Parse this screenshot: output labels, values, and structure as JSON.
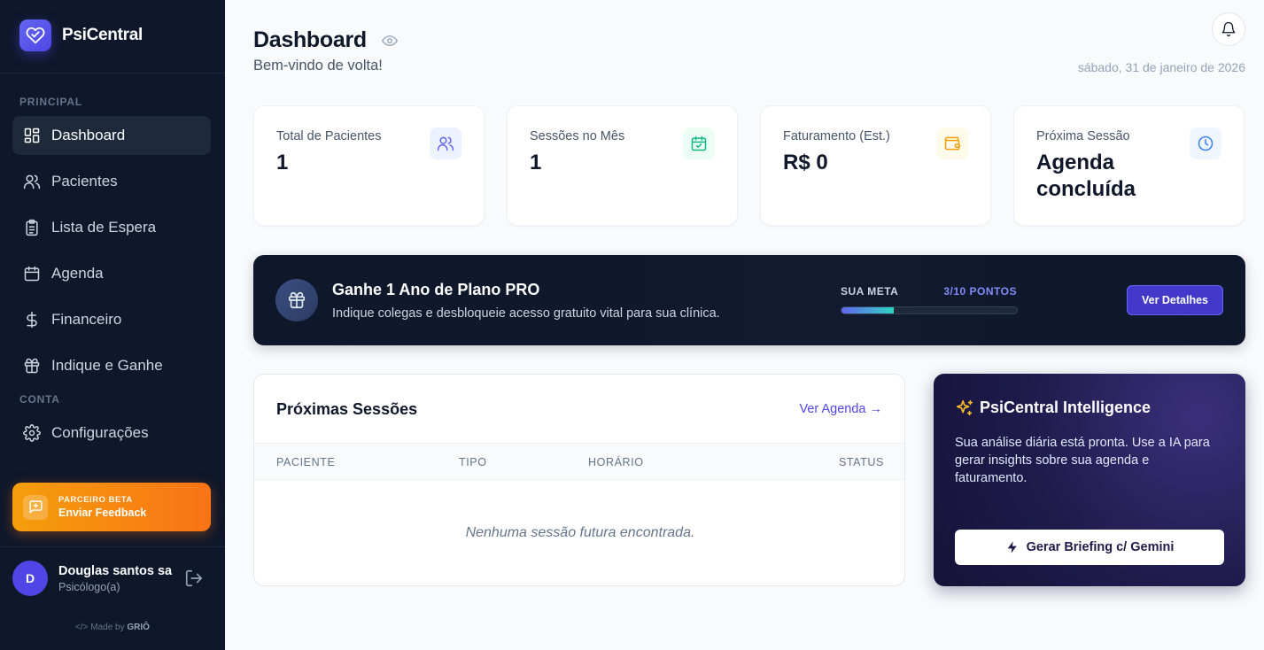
{
  "brand": {
    "name": "PsiCentral"
  },
  "sidebar": {
    "section_principal": "PRINCIPAL",
    "section_conta": "CONTA",
    "items": [
      {
        "label": "Dashboard",
        "icon": "grid-icon"
      },
      {
        "label": "Pacientes",
        "icon": "users-icon"
      },
      {
        "label": "Lista de Espera",
        "icon": "clipboard-icon"
      },
      {
        "label": "Agenda",
        "icon": "calendar-icon"
      },
      {
        "label": "Financeiro",
        "icon": "dollar-icon"
      },
      {
        "label": "Indique e Ganhe",
        "icon": "gift-icon"
      },
      {
        "label": "Configurações",
        "icon": "gear-icon"
      }
    ],
    "feedback": {
      "small": "PARCEIRO BETA",
      "main": "Enviar Feedback"
    },
    "user": {
      "initial": "D",
      "name": "Douglas santos sa",
      "role": "Psicólogo(a)"
    },
    "made_by_prefix": "Made by",
    "made_by_name": "GRIÔ"
  },
  "header": {
    "title": "Dashboard",
    "subtitle": "Bem-vindo de volta!",
    "date": "sábado, 31 de janeiro de 2026"
  },
  "stats": [
    {
      "label": "Total de Pacientes",
      "value": "1",
      "icon": "users-icon",
      "color": "#6366f1",
      "bg": "#eef2ff"
    },
    {
      "label": "Sessões no Mês",
      "value": "1",
      "icon": "calendar-check-icon",
      "color": "#10b981",
      "bg": "#ecfdf5"
    },
    {
      "label": "Faturamento (Est.)",
      "value": "R$ 0",
      "icon": "wallet-icon",
      "color": "#f59e0b",
      "bg": "#fffbeb"
    },
    {
      "label": "Próxima Sessão",
      "value": "Agenda concluída",
      "icon": "clock-icon",
      "color": "#3b82f6",
      "bg": "#eff6ff"
    }
  ],
  "promo": {
    "title": "Ganhe 1 Ano de Plano PRO",
    "description": "Indique colegas e desbloqueie acesso gratuito vital para sua clínica.",
    "goal_label": "SUA META",
    "goal_value": "3/10 PONTOS",
    "progress": 0.3,
    "button": "Ver Detalhes"
  },
  "sessions": {
    "title": "Próximas Sessões",
    "link": "Ver Agenda →",
    "columns": [
      "PACIENTE",
      "TIPO",
      "HORÁRIO",
      "STATUS"
    ],
    "empty": "Nenhuma sessão futura encontrada."
  },
  "ai": {
    "title": "PsiCentral Intelligence",
    "description": "Sua análise diária está pronta. Use a IA para gerar insights sobre sua agenda e faturamento.",
    "button": "Gerar Briefing c/ Gemini"
  },
  "colors": {
    "accent": "#4f46e5",
    "sidebar_bg": "#0f172a",
    "feedback_start": "#f59e0b",
    "feedback_end": "#f97316"
  }
}
